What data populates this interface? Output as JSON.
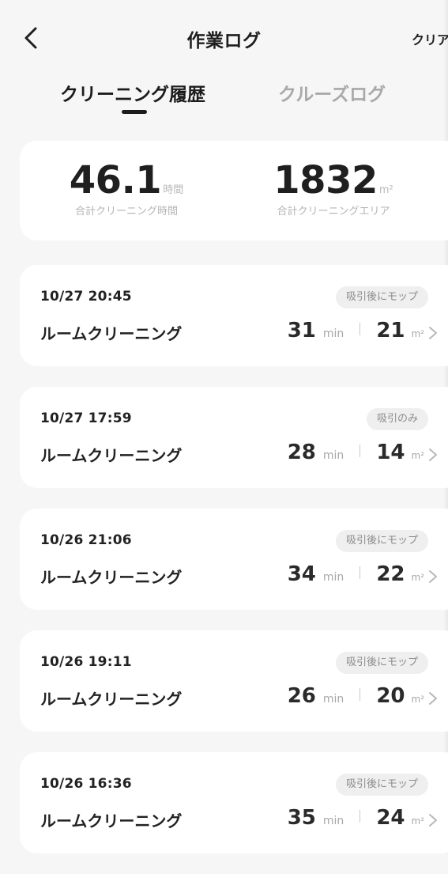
{
  "header": {
    "title": "作業ログ",
    "clear_label": "クリア"
  },
  "tabs": [
    {
      "label": "クリーニング履歴",
      "active": true
    },
    {
      "label": "クルーズログ",
      "active": false
    }
  ],
  "summary": {
    "total_time": {
      "value": "46.1",
      "unit": "時間",
      "label": "合計クリーニング時間"
    },
    "total_area": {
      "value": "1832",
      "unit": "m²",
      "label": "合計クリーニングエリア"
    }
  },
  "logs": [
    {
      "datetime": "10/27 20:45",
      "mode": "吸引後にモップ",
      "title": "ルームクリーニング",
      "duration": "31",
      "duration_unit": "min",
      "area": "21",
      "area_unit": "m²"
    },
    {
      "datetime": "10/27 17:59",
      "mode": "吸引のみ",
      "title": "ルームクリーニング",
      "duration": "28",
      "duration_unit": "min",
      "area": "14",
      "area_unit": "m²"
    },
    {
      "datetime": "10/26 21:06",
      "mode": "吸引後にモップ",
      "title": "ルームクリーニング",
      "duration": "34",
      "duration_unit": "min",
      "area": "22",
      "area_unit": "m²"
    },
    {
      "datetime": "10/26 19:11",
      "mode": "吸引後にモップ",
      "title": "ルームクリーニング",
      "duration": "26",
      "duration_unit": "min",
      "area": "20",
      "area_unit": "m²"
    },
    {
      "datetime": "10/26 16:36",
      "mode": "吸引後にモップ",
      "title": "ルームクリーニング",
      "duration": "35",
      "duration_unit": "min",
      "area": "24",
      "area_unit": "m²"
    }
  ],
  "icons": {
    "back": "back-arrow-icon",
    "chevron": "chevron-right-icon"
  },
  "colors": {
    "background": "#f6f6f7",
    "card": "#ffffff",
    "text_primary": "#222222",
    "text_muted": "#b4b4b4",
    "tab_inactive": "#a9a9a9",
    "badge_bg": "#efefef"
  }
}
